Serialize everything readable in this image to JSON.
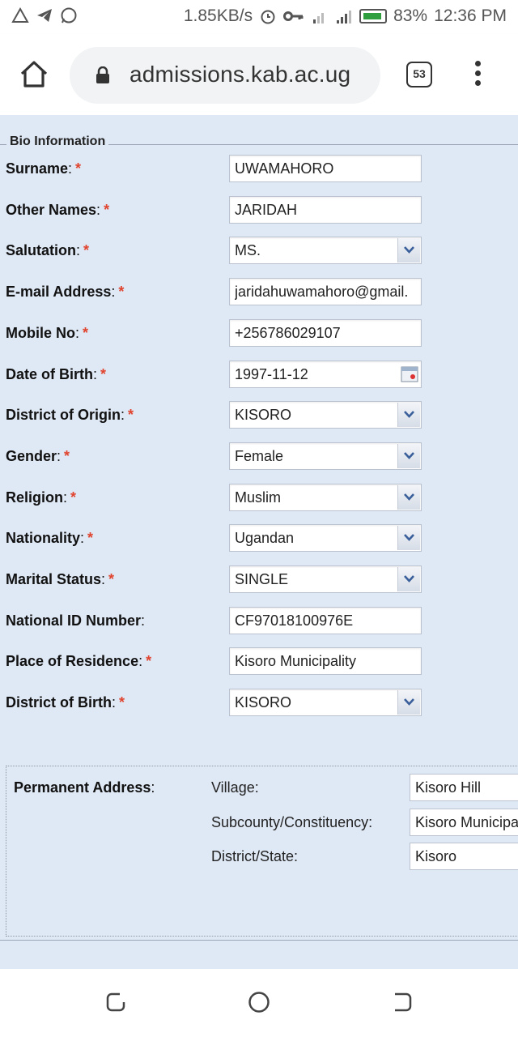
{
  "status_bar": {
    "icons_left": [
      "warning-icon",
      "telegram-icon",
      "whatsapp-icon"
    ],
    "speed": "1.85KB/s",
    "battery": "83%",
    "time": "12:36 PM"
  },
  "browser": {
    "url": "admissions.kab.ac.ug",
    "tab_count": "53"
  },
  "form": {
    "legend": "Bio Information",
    "fields": [
      {
        "label": "Surname",
        "value": "UWAMAHORO",
        "type": "text",
        "required": true
      },
      {
        "label": "Other Names",
        "value": "JARIDAH",
        "type": "text",
        "required": true
      },
      {
        "label": "Salutation",
        "value": "MS.",
        "type": "select",
        "required": true
      },
      {
        "label": "E-mail Address",
        "value": "jaridahuwamahoro@gmail.",
        "type": "text",
        "required": true
      },
      {
        "label": "Mobile No",
        "value": "+256786029107",
        "type": "text",
        "required": true
      },
      {
        "label": "Date of Birth",
        "value": "1997-11-12",
        "type": "date",
        "required": true
      },
      {
        "label": "District of Origin",
        "value": "KISORO",
        "type": "select",
        "required": true
      },
      {
        "label": "Gender",
        "value": "Female",
        "type": "select",
        "required": true
      },
      {
        "label": "Religion",
        "value": "Muslim",
        "type": "select",
        "required": true
      },
      {
        "label": "Nationality",
        "value": "Ugandan",
        "type": "select",
        "required": true
      },
      {
        "label": "Marital Status",
        "value": "SINGLE",
        "type": "select",
        "required": true
      },
      {
        "label": "National ID Number",
        "value": "CF97018100976E",
        "type": "text",
        "required": false
      },
      {
        "label": "Place of Residence",
        "value": "Kisoro Municipality",
        "type": "text",
        "required": true
      },
      {
        "label": "District of Birth",
        "value": "KISORO",
        "type": "select",
        "required": true
      }
    ],
    "required_mark": "*",
    "colon": ":"
  },
  "permanent_address": {
    "title": "Permanent Address",
    "rows": [
      {
        "label": "Village:",
        "value": "Kisoro Hill"
      },
      {
        "label": "Subcounty/Constituency:",
        "value": "Kisoro Municipality"
      },
      {
        "label": "District/State:",
        "value": "Kisoro"
      }
    ]
  },
  "colors": {
    "content_bg": "#dfe8f5",
    "required": "#e0442e",
    "battery": "#2e9e3e"
  }
}
